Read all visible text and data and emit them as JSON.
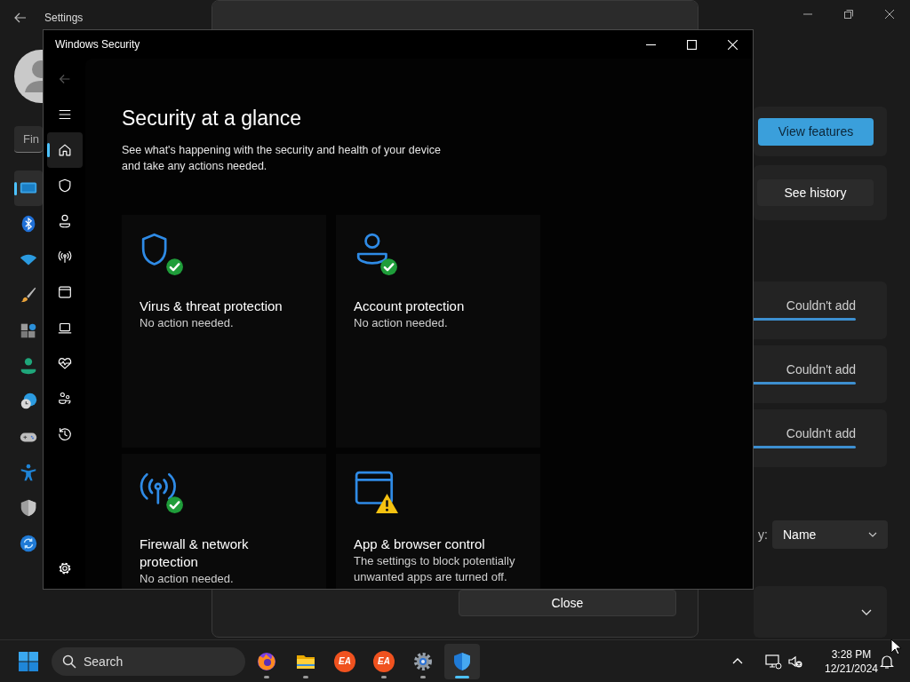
{
  "settings": {
    "title": "Settings",
    "search": {
      "placeholder": "Fin"
    },
    "nav": [
      {
        "kind": "display",
        "selected": true
      },
      {
        "kind": "bluetooth",
        "selected": false
      },
      {
        "kind": "wifi",
        "selected": false
      },
      {
        "kind": "brush",
        "selected": false
      },
      {
        "kind": "apps",
        "selected": false
      },
      {
        "kind": "person",
        "selected": false
      },
      {
        "kind": "clock",
        "selected": false
      },
      {
        "kind": "gamepad",
        "selected": false
      },
      {
        "kind": "accessibility",
        "selected": false
      },
      {
        "kind": "shield",
        "selected": false
      },
      {
        "kind": "update",
        "selected": false
      }
    ],
    "feature_button": "View features",
    "history_button": "See history",
    "items": [
      {
        "status": "Couldn't add"
      },
      {
        "status": "Couldn't add"
      },
      {
        "status": "Couldn't add"
      }
    ],
    "sort": {
      "label": "y:",
      "value": "Name"
    }
  },
  "dialog": {
    "close_button": "Close"
  },
  "security": {
    "title": "Windows Security",
    "nav": [
      {
        "kind": "back",
        "selected": false,
        "disabled": true
      },
      {
        "kind": "menu",
        "selected": false,
        "disabled": false
      },
      {
        "kind": "home",
        "selected": true,
        "disabled": false
      },
      {
        "kind": "shield",
        "selected": false,
        "disabled": false
      },
      {
        "kind": "person",
        "selected": false,
        "disabled": false
      },
      {
        "kind": "antenna",
        "selected": false,
        "disabled": false
      },
      {
        "kind": "window",
        "selected": false,
        "disabled": false
      },
      {
        "kind": "laptop",
        "selected": false,
        "disabled": false
      },
      {
        "kind": "heart",
        "selected": false,
        "disabled": false
      },
      {
        "kind": "family",
        "selected": false,
        "disabled": false
      },
      {
        "kind": "history",
        "selected": false,
        "disabled": false
      },
      {
        "kind": "gear",
        "selected": false,
        "disabled": false
      }
    ],
    "heading": "Security at a glance",
    "description": "See what's happening with the security and health of your device and take any actions needed.",
    "cards": [
      {
        "kind": "shield",
        "warning": false,
        "title": "Virus & threat protection",
        "subtitle": "No action needed."
      },
      {
        "kind": "person",
        "warning": false,
        "title": "Account protection",
        "subtitle": "No action needed."
      },
      {
        "kind": "antenna",
        "warning": false,
        "title": "Firewall & network protection",
        "subtitle": "No action needed."
      },
      {
        "kind": "window",
        "warning": true,
        "title": "App & browser control",
        "subtitle": "The settings to block potentially unwanted apps are turned off."
      }
    ]
  },
  "taskbar": {
    "search": "Search",
    "apps": [
      {
        "kind": "firefox",
        "running": true,
        "active": false
      },
      {
        "kind": "folder",
        "running": true,
        "active": false
      },
      {
        "kind": "ea",
        "label": "EA",
        "running": false,
        "active": false
      },
      {
        "kind": "ea",
        "label": "EA",
        "running": true,
        "active": false
      },
      {
        "kind": "gear",
        "running": true,
        "active": false
      },
      {
        "kind": "shield",
        "running": true,
        "active": true
      }
    ],
    "time": "3:28 PM",
    "date": "12/21/2024"
  }
}
